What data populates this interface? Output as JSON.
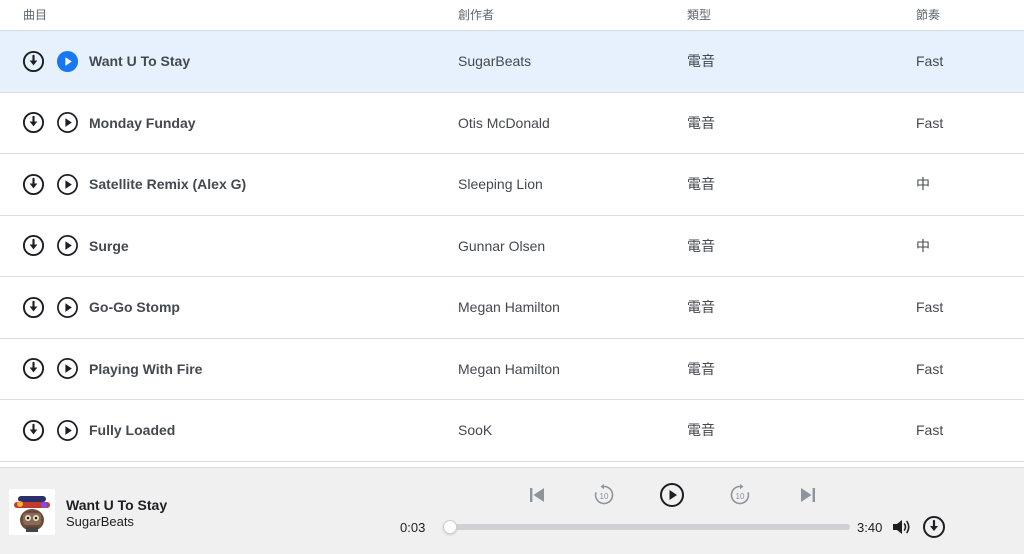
{
  "columns": {
    "title": "曲目",
    "artist": "創作者",
    "genre": "類型",
    "tempo": "節奏"
  },
  "tracks": [
    {
      "title": "Want U To Stay",
      "artist": "SugarBeats",
      "genre": "電音",
      "tempo": "Fast",
      "active": true
    },
    {
      "title": "Monday Funday",
      "artist": "Otis McDonald",
      "genre": "電音",
      "tempo": "Fast",
      "active": false
    },
    {
      "title": "Satellite Remix (Alex G)",
      "artist": "Sleeping Lion",
      "genre": "電音",
      "tempo": "中",
      "active": false
    },
    {
      "title": "Surge",
      "artist": "Gunnar Olsen",
      "genre": "電音",
      "tempo": "中",
      "active": false
    },
    {
      "title": "Go-Go Stomp",
      "artist": "Megan Hamilton",
      "genre": "電音",
      "tempo": "Fast",
      "active": false
    },
    {
      "title": "Playing With Fire",
      "artist": "Megan Hamilton",
      "genre": "電音",
      "tempo": "Fast",
      "active": false
    },
    {
      "title": "Fully Loaded",
      "artist": "SooK",
      "genre": "電音",
      "tempo": "Fast",
      "active": false
    }
  ],
  "player": {
    "now_playing_title": "Want U To Stay",
    "now_playing_artist": "SugarBeats",
    "elapsed": "0:03",
    "duration": "3:40",
    "progress_fraction": 0.014,
    "skip_back_seconds": "10",
    "skip_forward_seconds": "10"
  },
  "colors": {
    "accent": "#1877f2",
    "active_row_bg": "#e7f1fd",
    "icon_dark": "#1c1e21"
  },
  "icons": {
    "download": "download-circle-icon",
    "play": "play-circle-icon",
    "previous": "skip-previous-icon",
    "rewind": "rewind-10-icon",
    "forward": "forward-10-icon",
    "next": "skip-next-icon",
    "volume": "volume-icon"
  }
}
